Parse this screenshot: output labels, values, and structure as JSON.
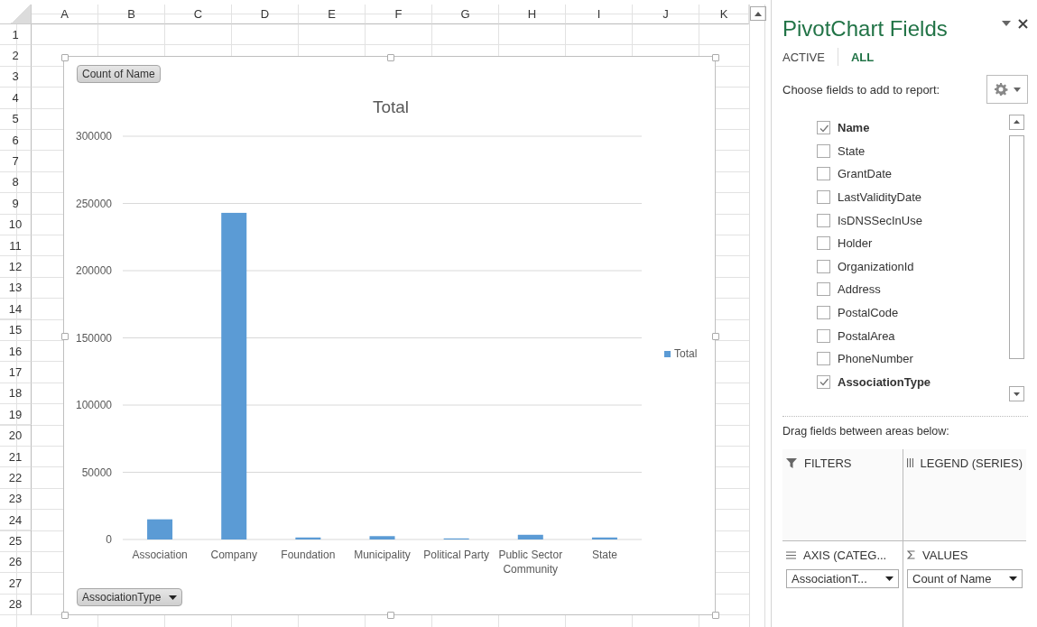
{
  "sheet": {
    "columns": [
      "A",
      "B",
      "C",
      "D",
      "E",
      "F",
      "G",
      "H",
      "I",
      "J",
      "K"
    ],
    "rows": [
      "1",
      "2",
      "3",
      "4",
      "5",
      "6",
      "7",
      "8",
      "9",
      "10",
      "11",
      "12",
      "13",
      "14",
      "15",
      "16",
      "17",
      "18",
      "19",
      "20",
      "21",
      "22",
      "23",
      "24",
      "25",
      "26",
      "27",
      "28"
    ]
  },
  "chart": {
    "value_button": "Count of Name",
    "axis_button": "AssociationType",
    "chart_data": {
      "type": "bar",
      "title": "Total",
      "categories": [
        "Association",
        "Company",
        "Foundation",
        "Municipality",
        "Political Party",
        "Public Sector Community",
        "State"
      ],
      "series": [
        {
          "name": "Total",
          "color": "#5b9bd5",
          "values": [
            15000,
            243000,
            1500,
            2500,
            800,
            3500,
            1500
          ]
        }
      ],
      "ylim": [
        0,
        300000
      ],
      "grid": true,
      "yticks": [
        0,
        50000,
        100000,
        150000,
        200000,
        250000,
        300000
      ]
    }
  },
  "panel": {
    "title": "PivotChart Fields",
    "tabs": [
      {
        "label": "ACTIVE",
        "selected": false
      },
      {
        "label": "ALL",
        "selected": true
      }
    ],
    "prompt": "Choose fields to add to report:",
    "fields": [
      {
        "label": "Name",
        "checked": true
      },
      {
        "label": "State",
        "checked": false
      },
      {
        "label": "GrantDate",
        "checked": false
      },
      {
        "label": "LastValidityDate",
        "checked": false
      },
      {
        "label": "IsDNSSecInUse",
        "checked": false
      },
      {
        "label": "Holder",
        "checked": false
      },
      {
        "label": "OrganizationId",
        "checked": false
      },
      {
        "label": "Address",
        "checked": false
      },
      {
        "label": "PostalCode",
        "checked": false
      },
      {
        "label": "PostalArea",
        "checked": false
      },
      {
        "label": "PhoneNumber",
        "checked": false
      },
      {
        "label": "AssociationType",
        "checked": true
      }
    ],
    "drag_hint": "Drag fields between areas below:",
    "areas": [
      {
        "kind": "filters",
        "label": "FILTERS"
      },
      {
        "kind": "legend",
        "label": "LEGEND (SERIES)"
      },
      {
        "kind": "axis",
        "label": "AXIS (CATEG...",
        "item": "AssociationT..."
      },
      {
        "kind": "values",
        "label": "VALUES",
        "item": "Count of Name"
      }
    ]
  }
}
